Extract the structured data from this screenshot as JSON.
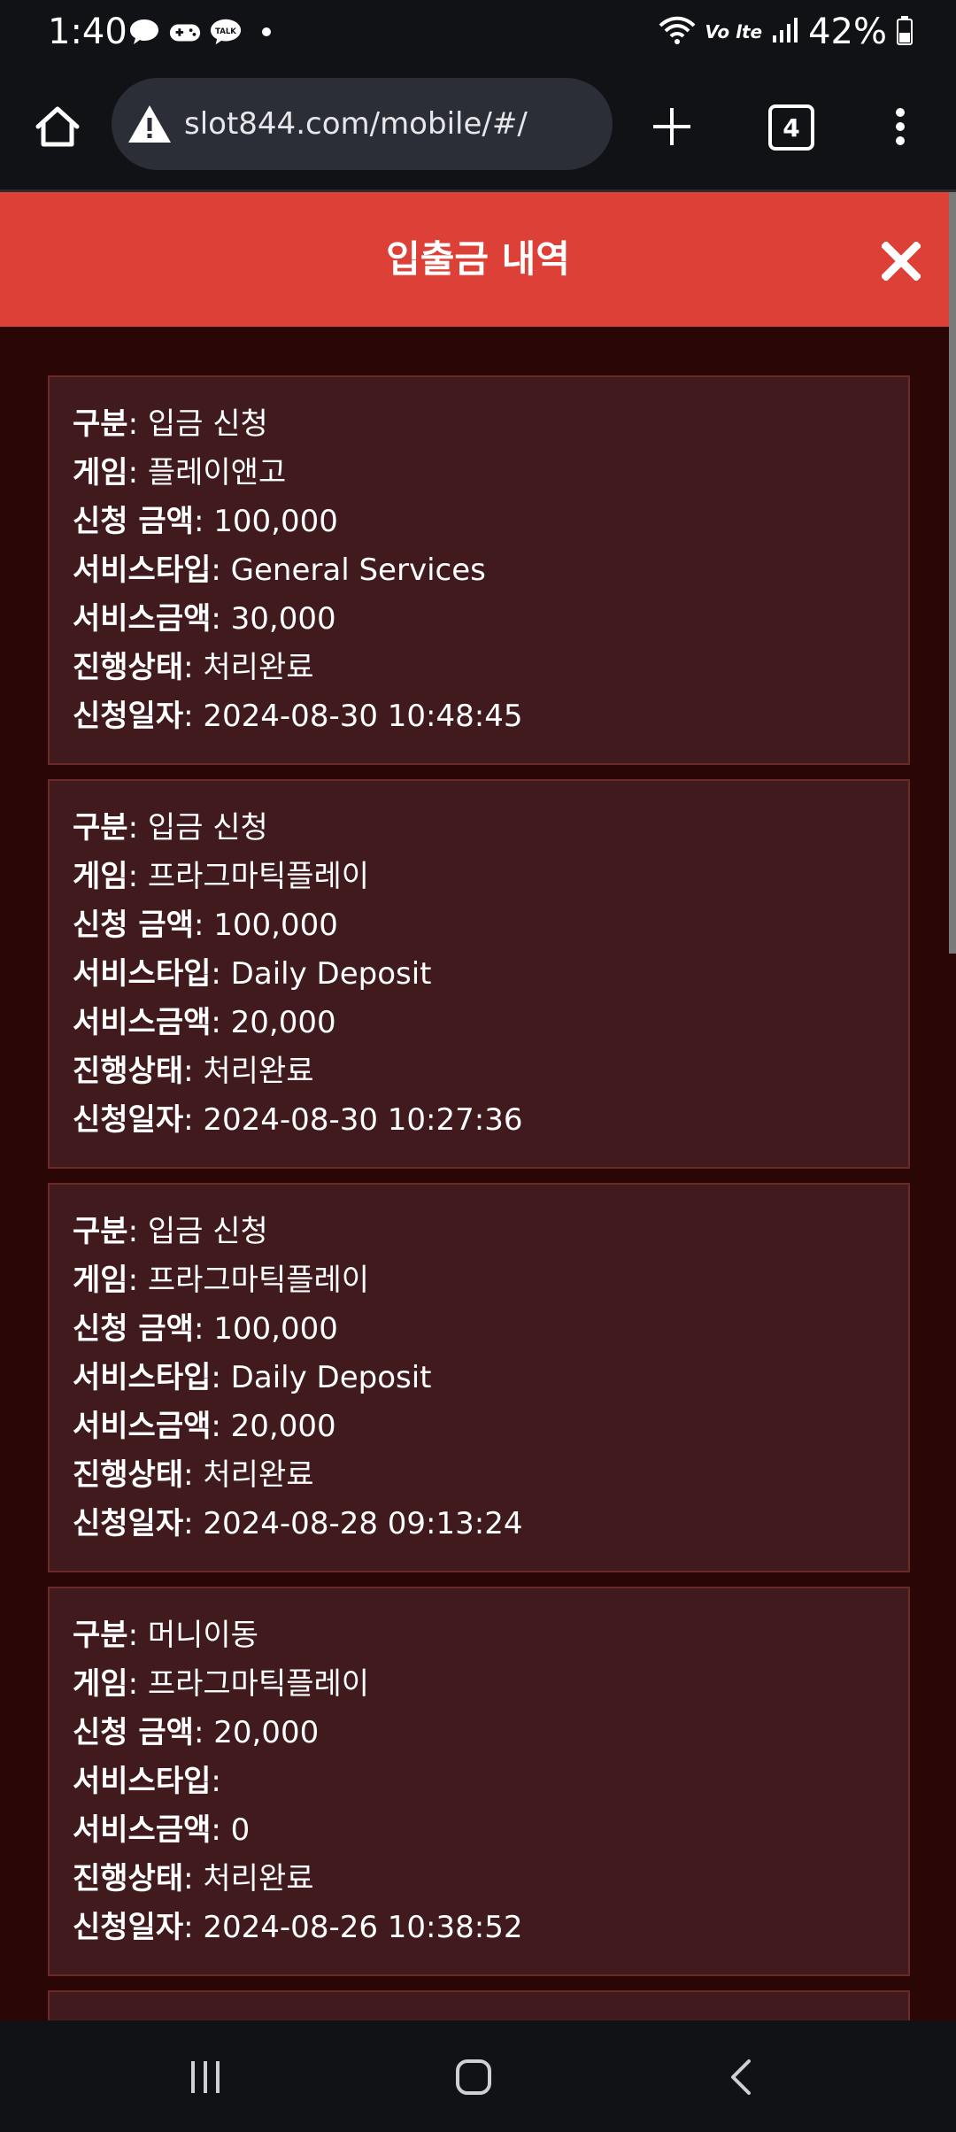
{
  "status_bar": {
    "time": "1:40",
    "network": "Vo lte",
    "battery": "42%"
  },
  "browser": {
    "url": "slot844.com/mobile/#/",
    "tab_count": "4"
  },
  "modal": {
    "title": "입출금 내역"
  },
  "labels": {
    "type": "구분",
    "game": "게임",
    "amount": "신청 금액",
    "service_type": "서비스타입",
    "service_amount": "서비스금액",
    "status": "진행상태",
    "date": "신청일자"
  },
  "records": [
    {
      "type": "입금 신청",
      "game": "플레이앤고",
      "amount": "100,000",
      "service_type": "General Services",
      "service_amount": "30,000",
      "status": "처리완료",
      "date": "2024-08-30 10:48:45"
    },
    {
      "type": "입금 신청",
      "game": "프라그마틱플레이",
      "amount": "100,000",
      "service_type": "Daily Deposit",
      "service_amount": "20,000",
      "status": "처리완료",
      "date": "2024-08-30 10:27:36"
    },
    {
      "type": "입금 신청",
      "game": "프라그마틱플레이",
      "amount": "100,000",
      "service_type": "Daily Deposit",
      "service_amount": "20,000",
      "status": "처리완료",
      "date": "2024-08-28 09:13:24"
    },
    {
      "type": "머니이동",
      "game": "프라그마틱플레이",
      "amount": "20,000",
      "service_type": "",
      "service_amount": "0",
      "status": "처리완료",
      "date": "2024-08-26 10:38:52"
    }
  ],
  "icons": {
    "home": "home-icon",
    "warning": "warning-icon",
    "new_tab": "plus-icon",
    "menu": "more-vert-icon",
    "close": "close-icon",
    "recents": "recents-icon",
    "home_nav": "home-nav-icon",
    "back": "back-icon"
  },
  "colors": {
    "header_red": "#dc4036",
    "background": "#2a0706",
    "card": "#401a1c",
    "card_border": "#6b2a2a"
  }
}
